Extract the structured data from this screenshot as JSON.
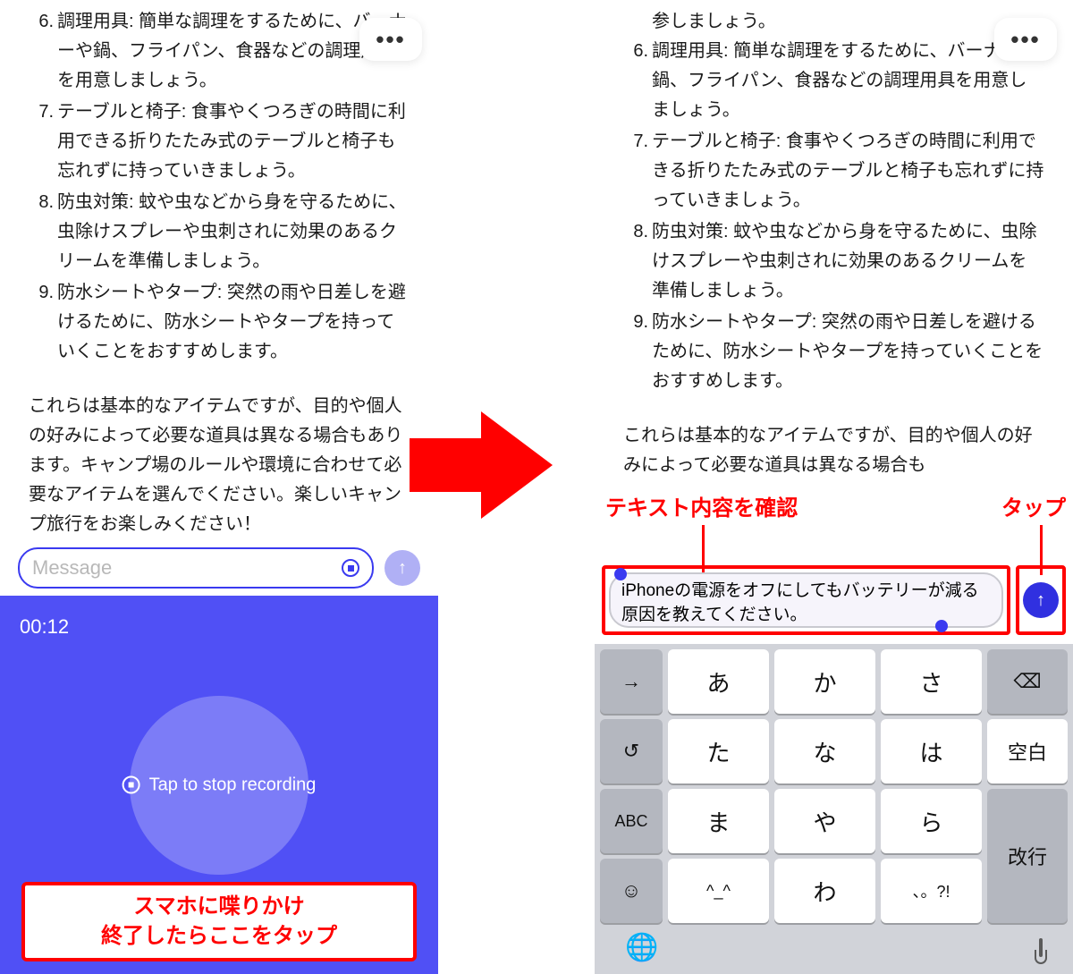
{
  "more_label": "•••",
  "left": {
    "list": [
      "調理用具: 簡単な調理をするために、バーナーや鍋、フライパン、食器などの調理用具を用意しましょう。",
      "テーブルと椅子: 食事やくつろぎの時間に利用できる折りたたみ式のテーブルと椅子も忘れずに持っていきましょう。",
      "防虫対策: 蚊や虫などから身を守るために、虫除けスプレーや虫刺されに効果のあるクリームを準備しましょう。",
      "防水シートやタープ: 突然の雨や日差しを避けるために、防水シートやタープを持っていくことをおすすめします。"
    ],
    "summary": "これらは基本的なアイテムですが、目的や個人の好みによって必要な道具は異なる場合もあります。キャンプ場のルールや環境に合わせて必要なアイテムを選んでください。楽しいキャンプ旅行をお楽しみください！",
    "msg_placeholder": "Message",
    "rec_time": "00:12",
    "tap_stop": "Tap to stop recording",
    "callout_l1": "スマホに喋りかけ",
    "callout_l2": "終了したらここをタップ"
  },
  "right": {
    "top_frag": "参しましょう。",
    "list": [
      "調理用具: 簡単な調理をするために、バーナーや鍋、フライパン、食器などの調理用具を用意しましょう。",
      "テーブルと椅子: 食事やくつろぎの時間に利用できる折りたたみ式のテーブルと椅子も忘れずに持っていきましょう。",
      "防虫対策: 蚊や虫などから身を守るために、虫除けスプレーや虫刺されに効果のあるクリームを準備しましょう。",
      "防水シートやタープ: 突然の雨や日差しを避けるために、防水シートやタープを持っていくことをおすすめします。"
    ],
    "summary": "これらは基本的なアイテムですが、目的や個人の好みによって必要な道具は異なる場合も",
    "anno_check": "テキスト内容を確認",
    "anno_tap": "タップ",
    "filled_text": "iPhoneの電源をオフにしてもバッテリーが減る原因を教えてください。"
  },
  "kb": {
    "fn": [
      "→",
      "↺",
      "ABC",
      "☺"
    ],
    "rows": [
      [
        "あ",
        "か",
        "さ"
      ],
      [
        "た",
        "な",
        "は"
      ],
      [
        "ま",
        "や",
        "ら"
      ],
      [
        "^_^",
        "わ",
        "、。?!"
      ]
    ],
    "right": [
      "⌫",
      "空白",
      "改行"
    ],
    "globe": "🌐"
  }
}
